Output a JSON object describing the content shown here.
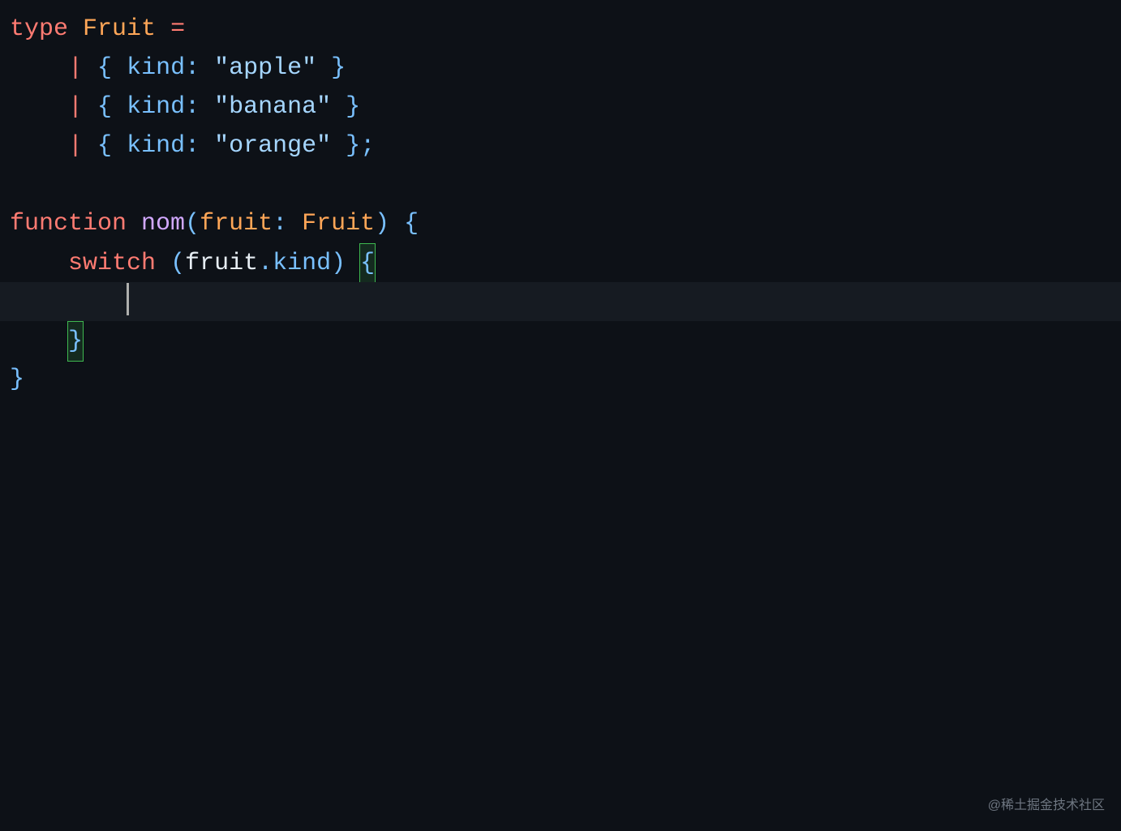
{
  "code": {
    "line1": {
      "keyword": "type",
      "typename": "Fruit",
      "equals": "="
    },
    "line2": {
      "pipe": "|",
      "lbrace": "{",
      "prop": "kind",
      "colon": ":",
      "string": "\"apple\"",
      "rbrace": "}"
    },
    "line3": {
      "pipe": "|",
      "lbrace": "{",
      "prop": "kind",
      "colon": ":",
      "string": "\"banana\"",
      "rbrace": "}"
    },
    "line4": {
      "pipe": "|",
      "lbrace": "{",
      "prop": "kind",
      "colon": ":",
      "string": "\"orange\"",
      "rbrace": "}",
      "semi": ";"
    },
    "line6": {
      "keyword": "function",
      "funcname": "nom",
      "lparen": "(",
      "param": "fruit",
      "colon": ":",
      "type": "Fruit",
      "rparen": ")",
      "lbrace": "{"
    },
    "line7": {
      "keyword": "switch",
      "lparen": "(",
      "obj": "fruit",
      "dot": ".",
      "prop": "kind",
      "rparen": ")",
      "lbrace": "{"
    },
    "line9": {
      "rbrace": "}"
    },
    "line10": {
      "rbrace": "}"
    }
  },
  "watermark": "@稀土掘金技术社区"
}
